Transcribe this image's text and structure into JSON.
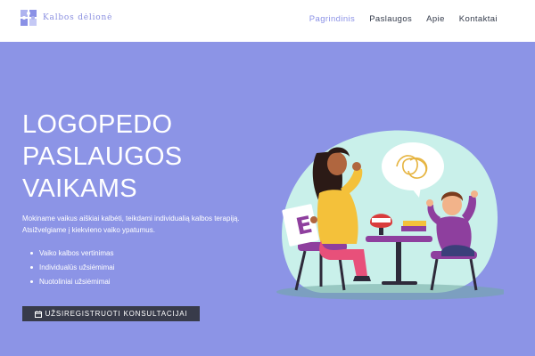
{
  "header": {
    "logo_text": "Kalbos dėlionė",
    "logo_icon": "puzzle-icon",
    "nav": [
      {
        "label": "Pagrindinis",
        "active": true
      },
      {
        "label": "Paslaugos",
        "active": false
      },
      {
        "label": "Apie",
        "active": false
      },
      {
        "label": "Kontaktai",
        "active": false
      }
    ]
  },
  "hero": {
    "title_lines": [
      "LOGOPEDO",
      "PASLAUGOS",
      "VAIKAMS"
    ],
    "description": "Mokiname vaikus aiškiai kalbėti, teikdami individualią kalbos terapiją. Atsižvelgiame į kiekvieno vaiko ypatumus.",
    "list": [
      "Vaiko kalbos vertinimas",
      "Individualūs užsiėmimai",
      "Nuotoliniai užsiėmimai"
    ],
    "cta_label": "UŽSIREGISTRUOTI KONSULTACIJAI",
    "cta_icon": "calendar-icon",
    "illustration": {
      "card_letter": "E"
    }
  },
  "colors": {
    "hero_bg": "#8c94e6",
    "accent": "#8a91e6",
    "cta_bg": "#383b4a",
    "nav_text": "#333a4a"
  }
}
